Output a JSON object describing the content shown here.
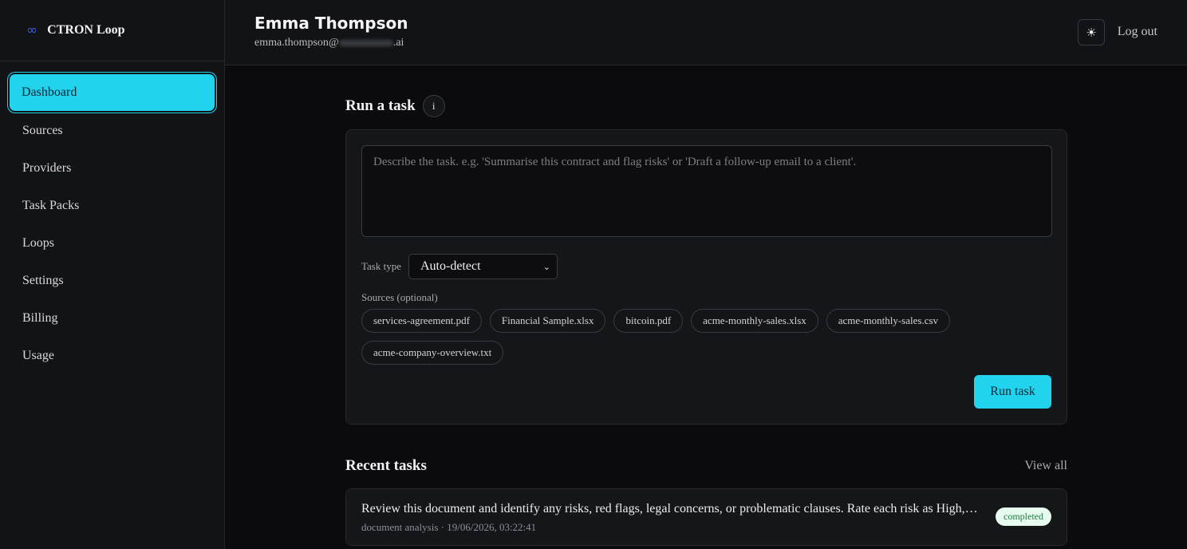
{
  "brand": {
    "icon": "infinity-icon",
    "name": "CTRON Loop"
  },
  "sidebar": {
    "items": [
      {
        "label": "Dashboard",
        "active": true
      },
      {
        "label": "Sources"
      },
      {
        "label": "Providers"
      },
      {
        "label": "Task Packs"
      },
      {
        "label": "Loops"
      },
      {
        "label": "Settings"
      },
      {
        "label": "Billing"
      },
      {
        "label": "Usage"
      }
    ]
  },
  "header": {
    "user_name": "Emma Thompson",
    "email_prefix": "emma.thompson@",
    "email_suffix": ".ai",
    "theme_icon": "sun-icon",
    "logout_label": "Log out"
  },
  "run_task": {
    "title": "Run a task",
    "info_label": "i",
    "placeholder": "Describe the task. e.g. 'Summarise this contract and flag risks' or 'Draft a follow-up email to a client'.",
    "task_type_label": "Task type",
    "task_type_value": "Auto-detect",
    "sources_label": "Sources (optional)",
    "sources": [
      "services-agreement.pdf",
      "Financial Sample.xlsx",
      "bitcoin.pdf",
      "acme-monthly-sales.xlsx",
      "acme-monthly-sales.csv",
      "acme-company-overview.txt"
    ],
    "run_button": "Run task"
  },
  "recent": {
    "title": "Recent tasks",
    "view_all": "View all",
    "tasks": [
      {
        "title": "Review this document and identify any risks, red flags, legal concerns, or problematic clauses. Rate each risk as High, Medium or Low.",
        "meta": "document analysis · 19/06/2026, 03:22:41",
        "status": "completed"
      }
    ]
  },
  "colors": {
    "accent": "#22d3ee",
    "background": "#0b0b0d",
    "panel": "#151619",
    "badge_bg": "#e8fbef",
    "badge_text": "#1d7a46"
  }
}
